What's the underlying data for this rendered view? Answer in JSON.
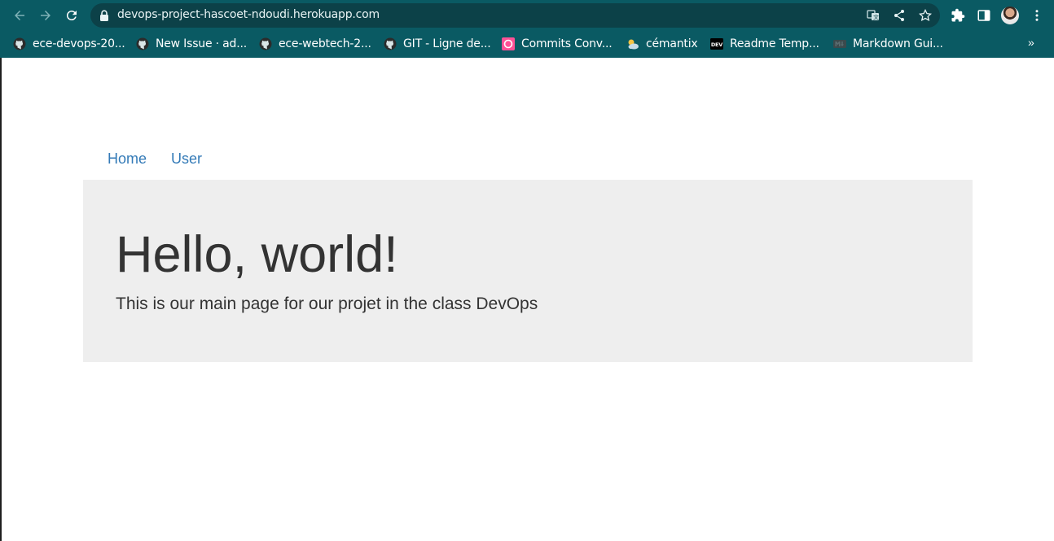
{
  "browser": {
    "url": "devops-project-hascoet-ndoudi.herokuapp.com",
    "bookmarks": [
      {
        "label": "ece-devops-20...",
        "icon": "github-icon"
      },
      {
        "label": "New Issue · ad...",
        "icon": "github-icon"
      },
      {
        "label": "ece-webtech-2...",
        "icon": "github-icon"
      },
      {
        "label": "GIT - Ligne de...",
        "icon": "github-icon"
      },
      {
        "label": "Commits Conv...",
        "icon": "conventional-commits-icon"
      },
      {
        "label": "cémantix",
        "icon": "weather-icon"
      },
      {
        "label": "Readme Temp...",
        "icon": "dev-icon"
      },
      {
        "label": "Markdown Gui...",
        "icon": "markdown-icon"
      }
    ],
    "more_bookmarks": "»"
  },
  "page": {
    "nav": {
      "home": "Home",
      "user": "User"
    },
    "hero": {
      "title": "Hello, world!",
      "text": "This is our main page for our projet in the class DevOps"
    }
  },
  "colors": {
    "chrome": "#0a5a63",
    "omnibox": "#0c4148",
    "link": "#337ab7",
    "jumbotron": "#eeeeee"
  }
}
